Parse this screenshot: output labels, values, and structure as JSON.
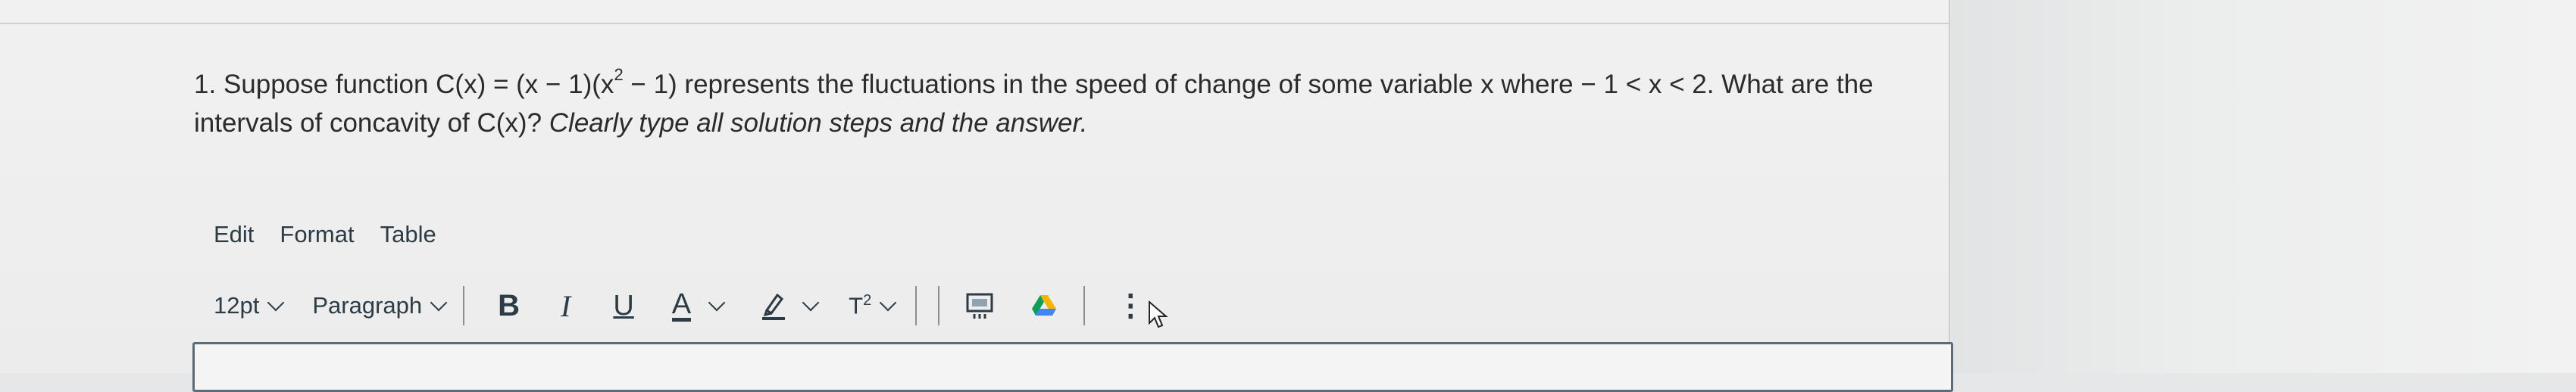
{
  "question": {
    "number": "1.",
    "line1_pre": "Suppose function C(x) = (x − 1)(x",
    "line1_sup": "2",
    "line1_post": " − 1) represents the fluctuations in the speed of change of some variable x where − 1 < x < 2. What are the",
    "line2_plain": "intervals of concavity of C(x)? ",
    "line2_italic": "Clearly type all solution steps and the answer."
  },
  "menubar": {
    "edit": "Edit",
    "format": "Format",
    "table": "Table"
  },
  "toolbar": {
    "font_size": "12pt",
    "block_format": "Paragraph",
    "bold": "B",
    "italic": "I",
    "underline": "U",
    "text_color": "A",
    "superscript_base": "T",
    "superscript_exp": "2",
    "more": "⋮"
  },
  "colors": {
    "drive_icon": [
      "#f4b400",
      "#0f9d58",
      "#4285f4"
    ]
  }
}
